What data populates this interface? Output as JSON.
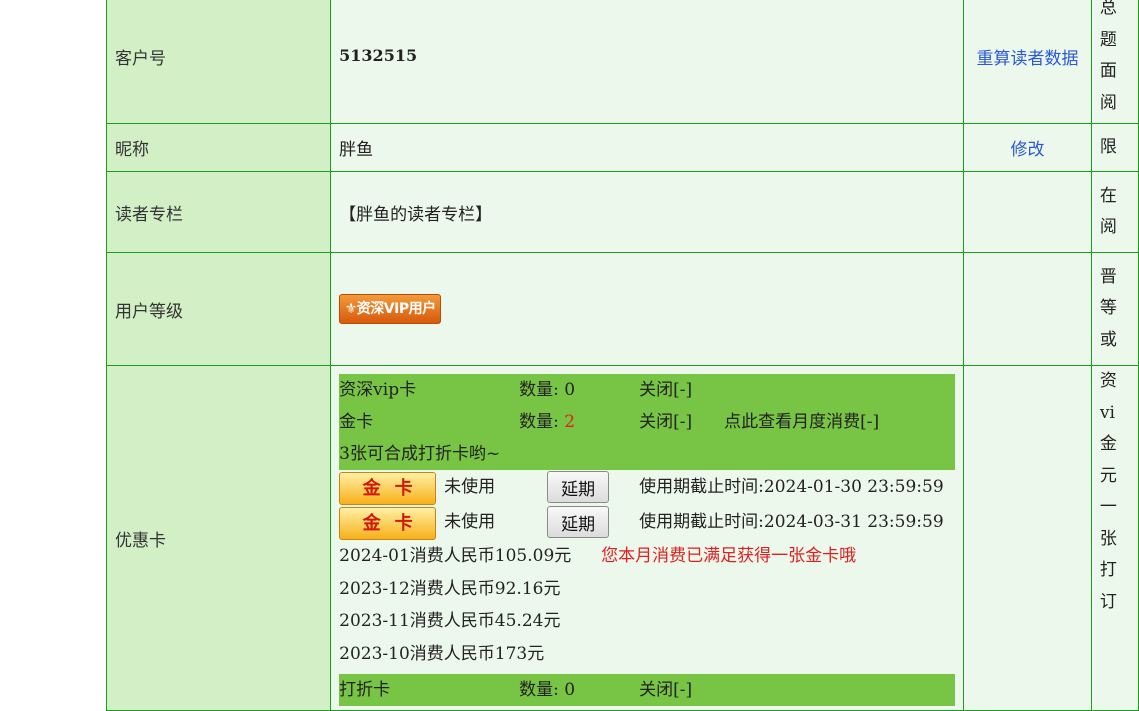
{
  "rows": {
    "customer": {
      "label": "客户号",
      "value": "5132515",
      "action": "重算读者数据",
      "side": [
        "总",
        "题",
        "面",
        "阅"
      ]
    },
    "nickname": {
      "label": "昵称",
      "value": "胖鱼",
      "action": "修改",
      "side": [
        "限"
      ]
    },
    "column": {
      "label": "读者专栏",
      "value": "【胖鱼的读者专栏】",
      "side": [
        "在",
        "阅"
      ]
    },
    "level": {
      "label": "用户等级",
      "badge": "⚜资深VIP用户",
      "side": [
        "晋",
        "等",
        "或"
      ]
    },
    "coupons": {
      "label": "优惠卡",
      "vip_card": {
        "name": "资深vip卡",
        "qty_label": "数量: ",
        "qty": "0",
        "toggle": "关闭[-]"
      },
      "gold_card": {
        "name": "金卡",
        "qty_label": "数量: ",
        "qty": "2",
        "toggle": "关闭[-]",
        "monthly_link": "点此查看月度消费[-]"
      },
      "combine_note": "3张可合成打折卡哟~",
      "cards": [
        {
          "label": "金卡",
          "status": "未使用",
          "button": "延期",
          "expiry": "使用期截止时间:2024-01-30 23:59:59"
        },
        {
          "label": "金卡",
          "status": "未使用",
          "button": "延期",
          "expiry": "使用期截止时间:2024-03-31 23:59:59"
        }
      ],
      "spending": [
        {
          "text": "2024-01消费人民币105.09元",
          "note": "您本月消费已满足获得一张金卡哦"
        },
        {
          "text": "2023-12消费人民币92.16元",
          "note": ""
        },
        {
          "text": "2023-11消费人民币45.24元",
          "note": ""
        },
        {
          "text": "2023-10消费人民币173元",
          "note": ""
        }
      ],
      "discount_card": {
        "name": "打折卡",
        "qty_label": "数量: ",
        "qty": "0",
        "toggle": "关闭[-]"
      },
      "side": [
        "资",
        "vi",
        "金",
        "元",
        "一",
        "张",
        "打",
        "订"
      ]
    }
  },
  "colors": {
    "label_bg": "#d3efc6",
    "cell_bg": "#edf8ec",
    "border": "#18a018",
    "green_box": "#78c444",
    "link": "#2a58d8",
    "red": "#e02020"
  }
}
